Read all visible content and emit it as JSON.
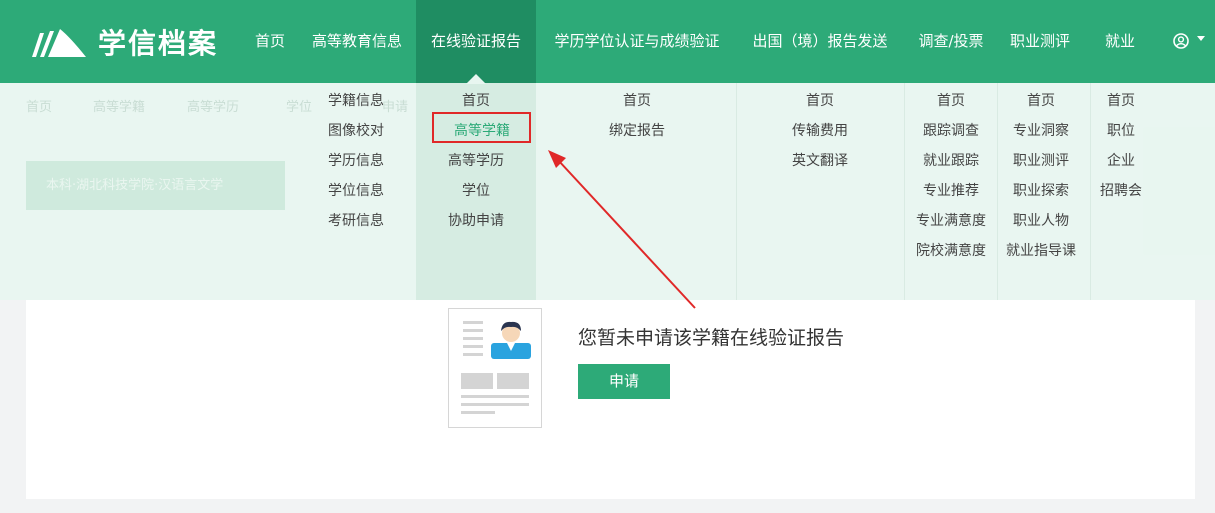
{
  "brand": {
    "name": "学信档案"
  },
  "nav": {
    "items": [
      {
        "label": "首页"
      },
      {
        "label": "高等教育信息"
      },
      {
        "label": "在线验证报告"
      },
      {
        "label": "学历学位认证与成绩验证"
      },
      {
        "label": "出国（境）报告发送"
      },
      {
        "label": "调查/投票"
      },
      {
        "label": "职业测评"
      },
      {
        "label": "就业"
      }
    ],
    "user_icon": "user-circle-icon"
  },
  "background_page": {
    "breadcrumb": [
      "首页",
      "高等学籍",
      "高等学历",
      "学位",
      "申请"
    ],
    "record_tag": "本科·湖北科技学院·汉语言文学"
  },
  "dropdown": {
    "col_education": [
      "学籍信息",
      "图像校对",
      "学历信息",
      "学位信息",
      "考研信息"
    ],
    "col_report": [
      "首页",
      "高等学籍",
      "高等学历",
      "学位",
      "协助申请"
    ],
    "col_cert": [
      "首页",
      "绑定报告"
    ],
    "col_abroad": [
      "首页",
      "传输费用",
      "英文翻译"
    ],
    "col_survey": [
      "首页",
      "跟踪调查",
      "就业跟踪",
      "专业推荐",
      "专业满意度",
      "院校满意度"
    ],
    "col_career": [
      "首页",
      "专业洞察",
      "职业测评",
      "职业探索",
      "职业人物",
      "就业指导课"
    ],
    "col_jobs": [
      "首页",
      "职位",
      "企业",
      "招聘会"
    ]
  },
  "main": {
    "message": "您暂未申请该学籍在线验证报告",
    "apply_label": "申请"
  },
  "colors": {
    "brand_green": "#2daa78",
    "active_green": "#1f8d62",
    "annotation_red": "#e02828"
  }
}
